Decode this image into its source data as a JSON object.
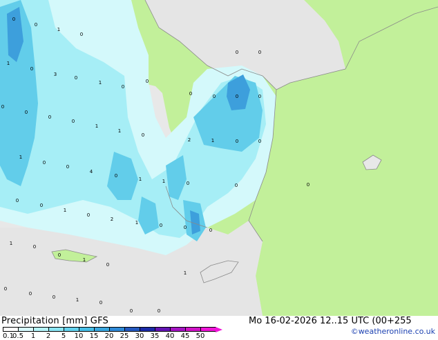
{
  "footer": {
    "title": "Precipitation [mm] GFS",
    "date": "Mo 16-02-2026 12..15 UTC (00+255",
    "credit": "©weatheronline.co.uk"
  },
  "legend": {
    "ticks": [
      "0.1",
      "0.5",
      "1",
      "2",
      "5",
      "10",
      "15",
      "20",
      "25",
      "30",
      "35",
      "40",
      "45",
      "50"
    ],
    "colors": [
      "#ffffff",
      "#d7fbff",
      "#b4f4fa",
      "#8ae6f5",
      "#63d3ef",
      "#46bfe8",
      "#3aa7e0",
      "#2f8ad8",
      "#2459c0",
      "#1c2ba8",
      "#6414b4",
      "#a514c4",
      "#d214c8",
      "#f014d8"
    ]
  },
  "colors": {
    "land": "#c2f09a",
    "land_dry": "#e5e5e5",
    "sea": "#e8e8e8",
    "precip_light": "#d4f9fb",
    "precip_medium": "#a6eef6",
    "precip_heavy": "#62cdea",
    "precip_core": "#3d9fdc"
  },
  "map": {
    "labels": [
      "0",
      "0",
      "1",
      "0",
      "0",
      "0",
      "1",
      "0",
      "3",
      "0",
      "1",
      "0",
      "0",
      "0",
      "0",
      "0",
      "0",
      "0",
      "0",
      "0",
      "0",
      "1",
      "1",
      "0",
      "2",
      "1",
      "0",
      "0",
      "1",
      "0",
      "0",
      "4",
      "0",
      "1",
      "1",
      "0",
      "0",
      "0",
      "0",
      "0",
      "1",
      "0",
      "2",
      "1",
      "0",
      "0",
      "0",
      "1",
      "0",
      "0",
      "1",
      "0",
      "1",
      "0",
      "0",
      "0",
      "1",
      "0",
      "0",
      "0"
    ]
  }
}
